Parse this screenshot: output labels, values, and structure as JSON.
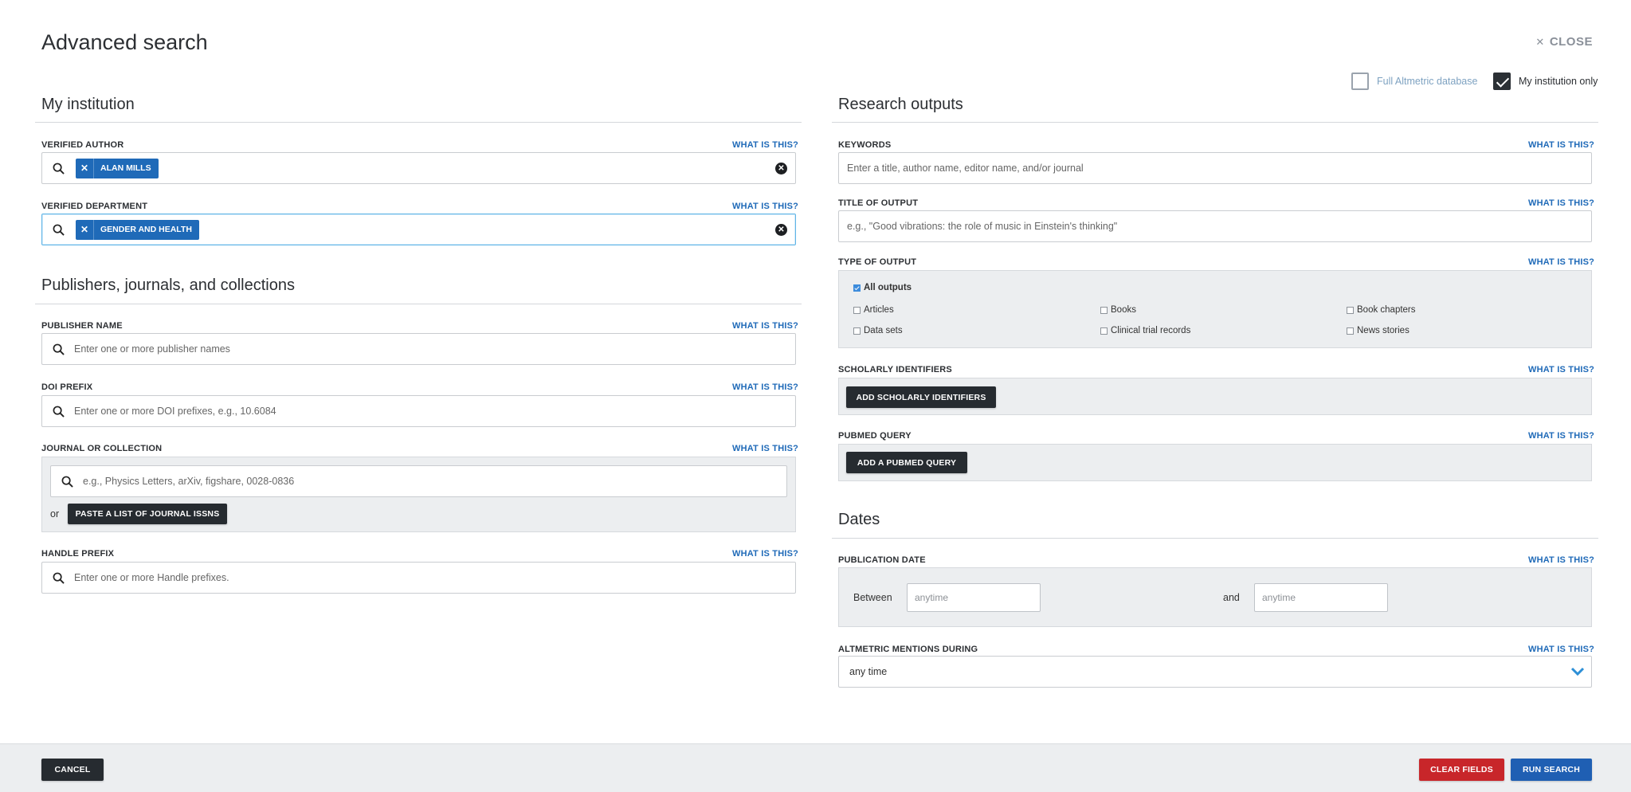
{
  "modal": {
    "title": "Advanced search",
    "close_label": "CLOSE",
    "scope": {
      "full_label": "Full Altmetric database",
      "full_checked": false,
      "mine_label": "My institution only",
      "mine_checked": true
    }
  },
  "what_is_this": "WHAT IS THIS?",
  "left": {
    "my_institution": {
      "title": "My institution",
      "verified_author": {
        "label": "VERIFIED AUTHOR",
        "tag": "ALAN MILLS"
      },
      "verified_department": {
        "label": "VERIFIED DEPARTMENT",
        "tag": "GENDER AND HEALTH"
      }
    },
    "publishers": {
      "title": "Publishers, journals, and collections",
      "publisher_name": {
        "label": "PUBLISHER NAME",
        "placeholder": "Enter one or more publisher names"
      },
      "doi_prefix": {
        "label": "DOI PREFIX",
        "placeholder": "Enter one or more DOI prefixes, e.g., 10.6084"
      },
      "journal": {
        "label": "JOURNAL OR COLLECTION",
        "placeholder": "e.g., Physics Letters, arXiv, figshare, 0028-0836",
        "or_text": "or",
        "paste_button": "PASTE A LIST OF JOURNAL ISSNS"
      },
      "handle_prefix": {
        "label": "HANDLE PREFIX",
        "placeholder": "Enter one or more Handle prefixes."
      }
    }
  },
  "right": {
    "research_outputs": {
      "title": "Research outputs",
      "keywords": {
        "label": "KEYWORDS",
        "placeholder": "Enter a title, author name, editor name, and/or journal"
      },
      "title_of_output": {
        "label": "TITLE OF OUTPUT",
        "placeholder": "e.g., \"Good vibrations: the role of music in Einstein's thinking\""
      },
      "type_of_output": {
        "label": "TYPE OF OUTPUT",
        "all_outputs": "All outputs",
        "options": [
          "Articles",
          "Books",
          "Book chapters",
          "Data sets",
          "Clinical trial records",
          "News stories"
        ]
      },
      "scholarly_identifiers": {
        "label": "SCHOLARLY IDENTIFIERS",
        "button": "ADD SCHOLARLY IDENTIFIERS"
      },
      "pubmed_query": {
        "label": "PUBMED QUERY",
        "button": "ADD A PUBMED QUERY"
      }
    },
    "dates": {
      "title": "Dates",
      "publication_date": {
        "label": "PUBLICATION DATE",
        "between_text": "Between",
        "and_text": "and",
        "from_placeholder": "anytime",
        "to_placeholder": "anytime"
      },
      "mentions_during": {
        "label": "ALTMETRIC MENTIONS DURING",
        "value": "any time"
      }
    }
  },
  "footer": {
    "cancel": "CANCEL",
    "clear_fields": "CLEAR FIELDS",
    "run_search": "RUN SEARCH"
  },
  "colors": {
    "accent_blue": "#1f6ab8",
    "dark_button": "#262b30",
    "clear_red": "#c8262a",
    "run_blue": "#1f5fb3"
  }
}
